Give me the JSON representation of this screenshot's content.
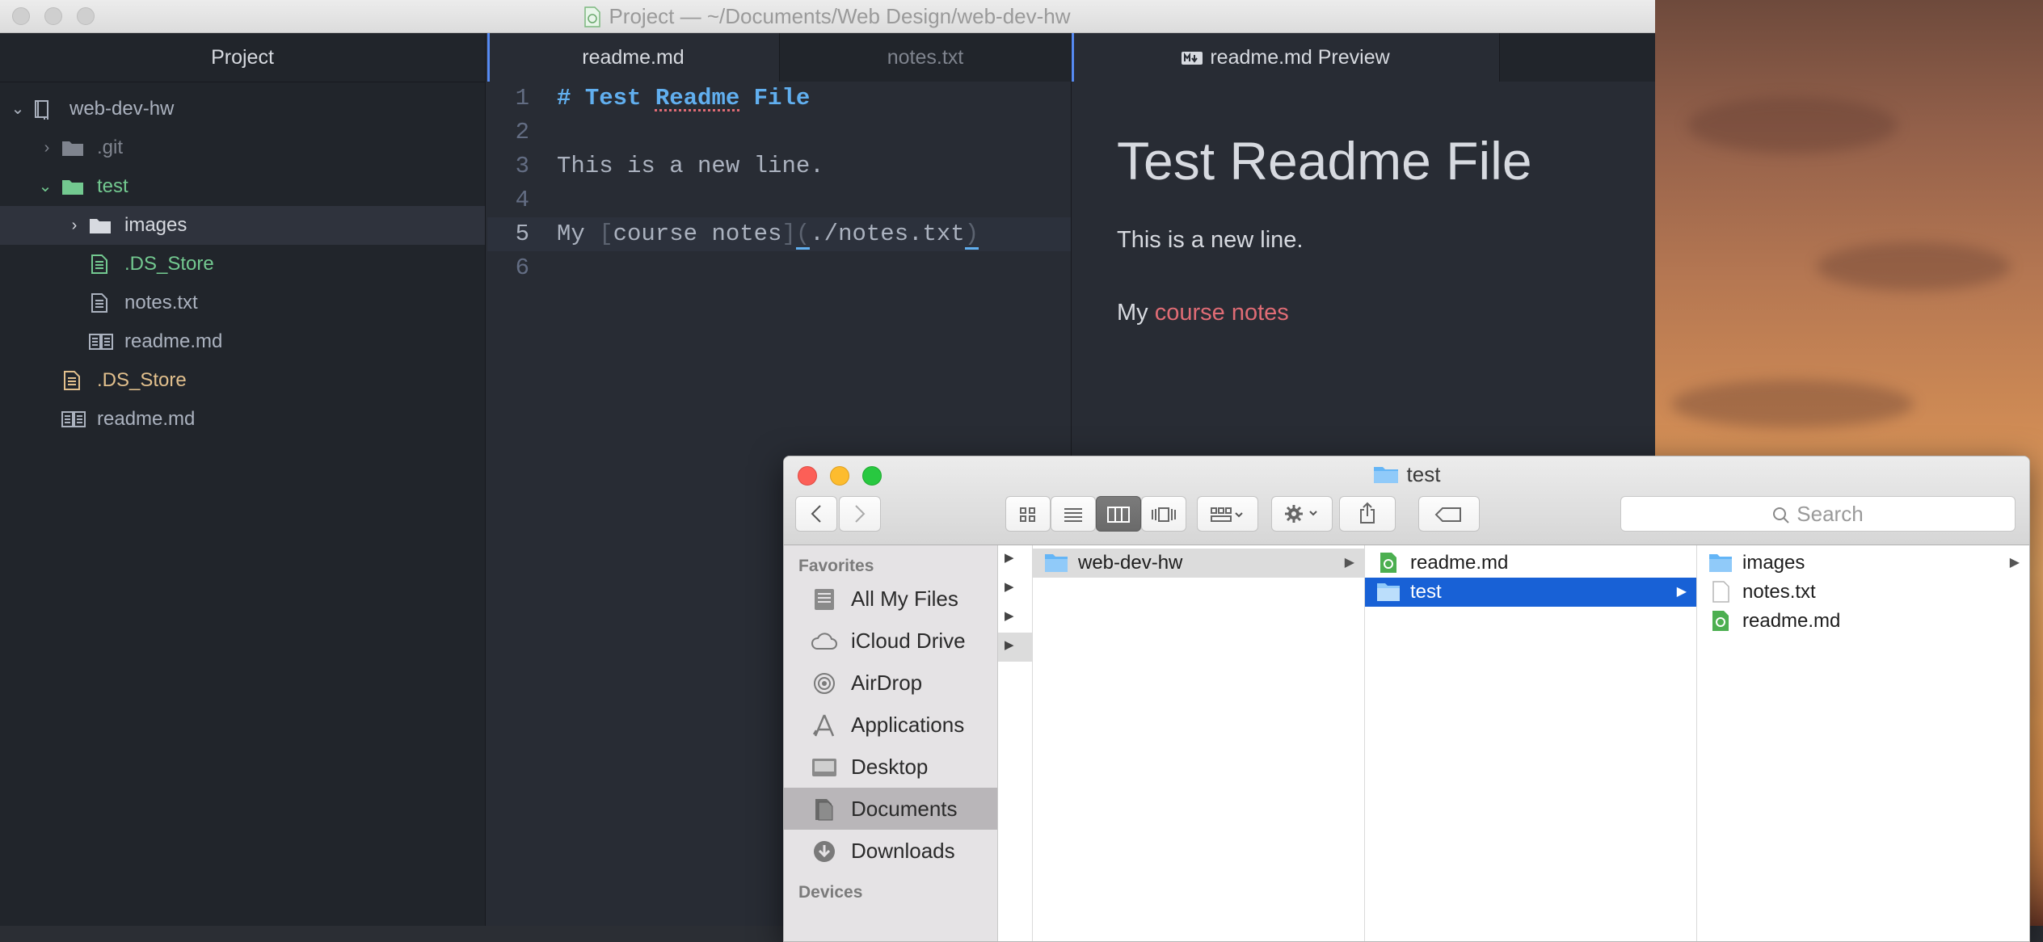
{
  "atom": {
    "window_title": "Project — ~/Documents/Web Design/web-dev-hw",
    "tree_header": "Project",
    "tree": [
      {
        "label": "web-dev-hw",
        "kind": "repo",
        "chevron": "⌄"
      },
      {
        "label": ".git",
        "kind": "folder",
        "chevron": "›"
      },
      {
        "label": "test",
        "kind": "folder-open",
        "chevron": "⌄"
      },
      {
        "label": "images",
        "kind": "folder",
        "chevron": "›"
      },
      {
        "label": ".DS_Store",
        "kind": "file"
      },
      {
        "label": "notes.txt",
        "kind": "file"
      },
      {
        "label": "readme.md",
        "kind": "book"
      },
      {
        "label": ".DS_Store",
        "kind": "file"
      },
      {
        "label": "readme.md",
        "kind": "book"
      }
    ],
    "tabs": [
      "readme.md",
      "notes.txt",
      "readme.md Preview"
    ],
    "gutter": [
      "1",
      "2",
      "3",
      "4",
      "5",
      "6"
    ],
    "code": {
      "line1_hash": "# ",
      "line1_a": "Test ",
      "line1_b": "Readme",
      "line1_c": " File",
      "line3": "This is a new line.",
      "line5_my": "My ",
      "line5_lb": "[",
      "line5_text": "course notes",
      "line5_rb": "]",
      "line5_lp": "(",
      "line5_url": "./notes.txt",
      "line5_rp": ")"
    },
    "preview": {
      "h1": "Test Readme File",
      "p1": "This is a new line.",
      "p2_prefix": "My ",
      "p2_link": "course notes"
    }
  },
  "finder": {
    "title": "test",
    "search_placeholder": "Search",
    "sidebar_sections": [
      "Favorites",
      "Devices"
    ],
    "favorites": [
      "All My Files",
      "iCloud Drive",
      "AirDrop",
      "Applications",
      "Desktop",
      "Documents",
      "Downloads"
    ],
    "col1": [
      "web-dev-hw"
    ],
    "col2": [
      "readme.md",
      "test"
    ],
    "col3": [
      "images",
      "notes.txt",
      "readme.md"
    ],
    "colors": {
      "selection": "#1861d6",
      "folder": "#64b5f6"
    }
  }
}
